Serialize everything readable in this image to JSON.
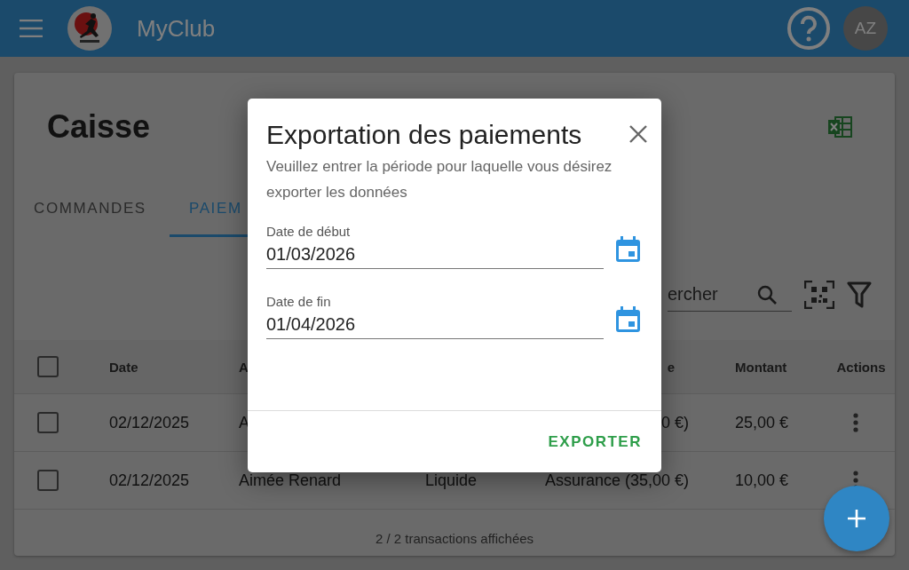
{
  "app_bar": {
    "title": "MyClub",
    "avatar": "AZ"
  },
  "page": {
    "title": "Caisse",
    "tabs": [
      {
        "label": "COMMANDES",
        "selected": false
      },
      {
        "label": "PAIEM",
        "selected": true
      }
    ],
    "search": {
      "placeholder": "ercher"
    },
    "table": {
      "header_checkbox": {
        "checked": false
      },
      "columns": [
        {
          "label": "Date",
          "kind": "date"
        },
        {
          "label": "A",
          "kind": "name"
        },
        {
          "label": "e",
          "kind": "description"
        },
        {
          "label": "Montant",
          "kind": "amount"
        },
        {
          "label": "Actions",
          "kind": "actions"
        }
      ],
      "rows": [
        {
          "checked": false,
          "date": "02/12/2025",
          "name": "A",
          "description": "0 €)",
          "amount": "25,00 €"
        },
        {
          "checked": false,
          "date": "02/12/2025",
          "name": "Aimée Renard",
          "method": "Liquide",
          "description": "Assurance (35,00 €)",
          "amount": "10,00 €"
        }
      ],
      "footer": "2 / 2 transactions affichées"
    }
  },
  "dialog": {
    "title": "Exportation des paiements",
    "subtitle": "Veuillez entrer la période pour laquelle vous désirez exporter les données",
    "fields": [
      {
        "label": "Date de début",
        "value": "01/03/2026"
      },
      {
        "label": "Date de fin",
        "value": "01/04/2026"
      }
    ],
    "button": "EXPORTER"
  }
}
